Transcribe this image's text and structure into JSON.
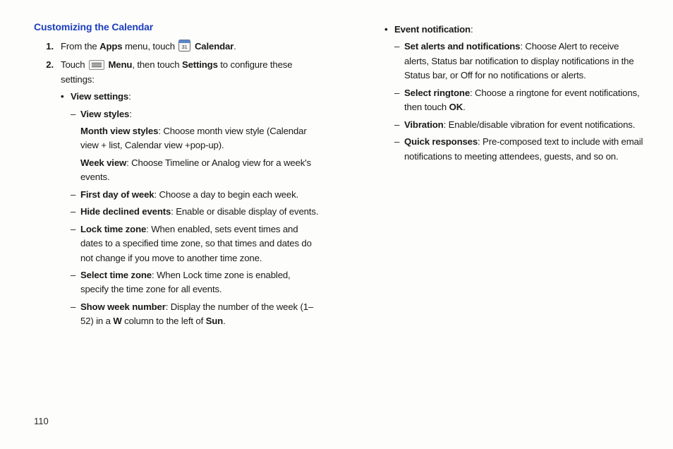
{
  "page_number": "110",
  "title": "Customizing the Calendar",
  "step1": {
    "from_the": "From the ",
    "apps": "Apps",
    "menu_touch": " menu, touch ",
    "calendar": "Calendar",
    "period": "."
  },
  "step2": {
    "touch": "Touch ",
    "menu": "Menu",
    "then_touch": ", then touch ",
    "settings": "Settings",
    "tail": " to configure these settings:"
  },
  "view_settings_label": "View settings",
  "view_styles_label": "View styles",
  "month_view": {
    "label": "Month view styles",
    "text": ": Choose month view style (Calendar view + list, Calendar view +pop-up)."
  },
  "week_view": {
    "label": "Week view",
    "text": ": Choose Timeline or Analog view for a week's events."
  },
  "first_day": {
    "label": "First day of week",
    "text": ": Choose a day to begin each week."
  },
  "hide_declined": {
    "label": "Hide declined events",
    "text": ": Enable or disable display of events."
  },
  "lock_tz": {
    "label": "Lock time zone",
    "text": ": When enabled, sets event times and dates to a specified time zone, so that times and dates do not change if you move to another time zone."
  },
  "select_tz": {
    "label": "Select time zone",
    "text": ": When Lock time zone is enabled, specify the time zone for all events."
  },
  "show_week": {
    "label": "Show week number",
    "pre": ": Display the number of the week (1–52) in a ",
    "w": "W",
    "mid": " column to the left of ",
    "sun": "Sun",
    "period": "."
  },
  "event_notif_label": "Event notification",
  "set_alerts": {
    "label": "Set alerts and notifications",
    "text": ": Choose Alert to receive alerts, Status bar notification to display notifications in the Status bar, or Off for no notifications or alerts."
  },
  "select_ringtone": {
    "label": "Select ringtone",
    "pre": ": Choose a ringtone for event notifications, then touch ",
    "ok": "OK",
    "period": "."
  },
  "vibration": {
    "label": "Vibration",
    "text": ": Enable/disable vibration for event notifications."
  },
  "quick_responses": {
    "label": "Quick responses",
    "text": ": Pre-composed text to include with email notifications to meeting attendees, guests, and so on."
  },
  "colon": ":"
}
